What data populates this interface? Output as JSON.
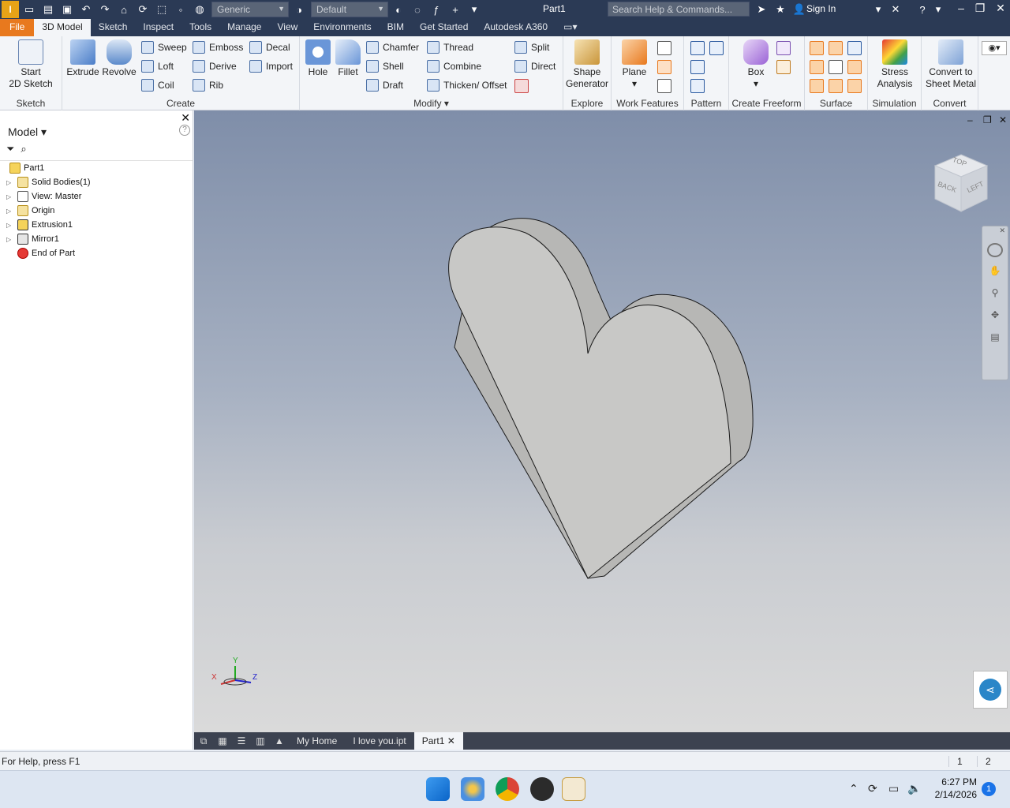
{
  "titlebar": {
    "material": "Generic",
    "appearance": "Default",
    "document_title": "Part1",
    "search_placeholder": "Search Help & Commands...",
    "sign_in": "Sign In"
  },
  "ribbon_tabs": [
    "File",
    "3D Model",
    "Sketch",
    "Inspect",
    "Tools",
    "Manage",
    "View",
    "Environments",
    "BIM",
    "Get Started",
    "Autodesk A360"
  ],
  "ribbon": {
    "sketch": {
      "label": "Sketch",
      "start": "Start",
      "sketch2d": "2D Sketch"
    },
    "create": {
      "label": "Create",
      "extrude": "Extrude",
      "revolve": "Revolve",
      "sweep": "Sweep",
      "loft": "Loft",
      "coil": "Coil",
      "emboss": "Emboss",
      "derive": "Derive",
      "rib": "Rib",
      "decal": "Decal",
      "import": "Import"
    },
    "modify": {
      "label": "Modify",
      "hole": "Hole",
      "fillet": "Fillet",
      "chamfer": "Chamfer",
      "shell": "Shell",
      "draft": "Draft",
      "thread": "Thread",
      "combine": "Combine",
      "thicken": "Thicken/ Offset",
      "split": "Split",
      "direct": "Direct"
    },
    "explore": {
      "label": "Explore",
      "shape1": "Shape",
      "shape2": "Generator"
    },
    "work_features": {
      "label": "Work Features",
      "plane": "Plane"
    },
    "pattern": {
      "label": "Pattern"
    },
    "freeform": {
      "label": "Create Freeform",
      "box": "Box"
    },
    "surface": {
      "label": "Surface"
    },
    "simulation": {
      "label": "Simulation",
      "stress1": "Stress",
      "stress2": "Analysis"
    },
    "convert": {
      "label": "Convert",
      "c1": "Convert to",
      "c2": "Sheet Metal"
    }
  },
  "browser": {
    "title": "Model",
    "items": [
      {
        "label": "Part1",
        "expandable": false
      },
      {
        "label": "Solid Bodies(1)",
        "expandable": true
      },
      {
        "label": "View: Master",
        "expandable": true
      },
      {
        "label": "Origin",
        "expandable": true
      },
      {
        "label": "Extrusion1",
        "expandable": true
      },
      {
        "label": "Mirror1",
        "expandable": true
      },
      {
        "label": "End of Part",
        "expandable": false
      }
    ]
  },
  "viewcube": {
    "top": "TOP",
    "back": "BACK",
    "left": "LEFT"
  },
  "triad": {
    "x": "X",
    "y": "Y",
    "z": "Z"
  },
  "doc_tabs": [
    "My Home",
    "I love you.ipt",
    "Part1"
  ],
  "status": {
    "message": "For Help, press F1",
    "n1": "1",
    "n2": "2"
  },
  "clock": {
    "time": "6:27 PM",
    "date": "2/14/2026",
    "notifications": "1"
  },
  "colors": {
    "titlebar": "#2b3a55",
    "file_tab": "#e8791e",
    "model": "#c8c8c6"
  }
}
